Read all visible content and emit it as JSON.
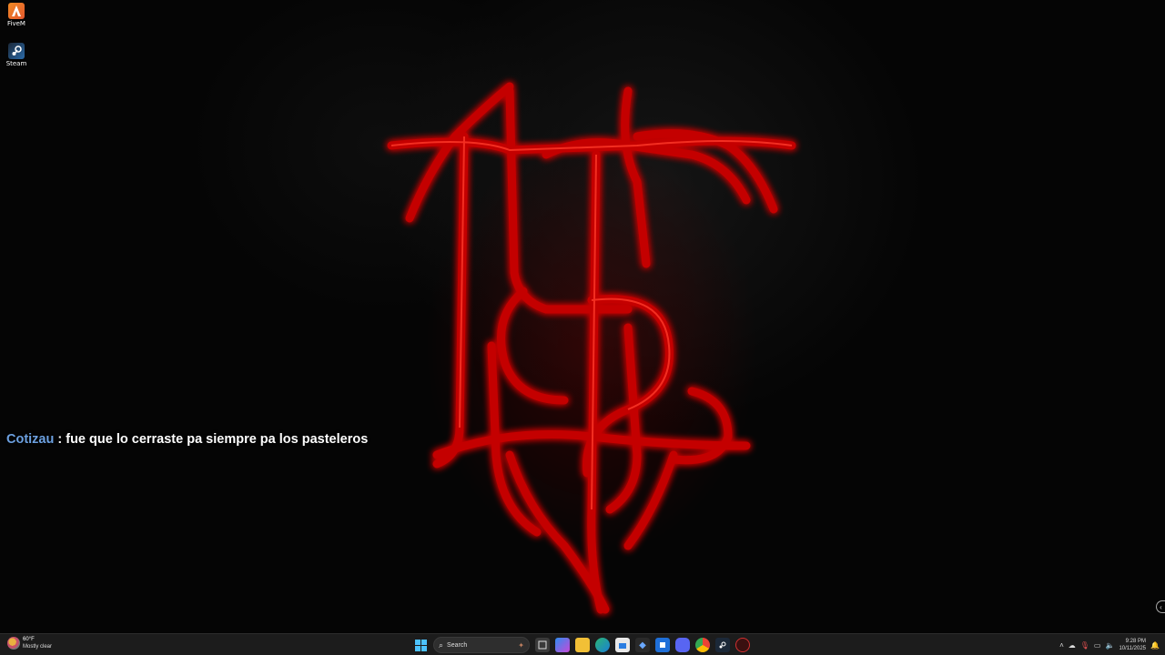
{
  "desktop": {
    "icons": [
      {
        "label": "FiveM",
        "icon": "fivem-icon"
      },
      {
        "label": "Steam",
        "icon": "steam-icon"
      }
    ]
  },
  "chat": {
    "username": "Cotizau",
    "separator": " : ",
    "message": "fue que lo cerraste pa siempre pa los pasteleros",
    "username_color": "#6ca0e0"
  },
  "taskbar": {
    "weather": {
      "temp": "60°F",
      "condition": "Mostly clear"
    },
    "search_placeholder": "Search",
    "apps": [
      "windows-start-icon",
      "search-icon",
      "task-view-icon",
      "copilot-icon",
      "file-explorer-icon",
      "edge-icon",
      "store-icon",
      "vpn-icon",
      "outlook-icon",
      "discord-icon",
      "chrome-icon",
      "steam-icon",
      "fivem-tray-icon"
    ],
    "tray": {
      "time": "9:28 PM",
      "date": "10/11/2025"
    }
  },
  "colors": {
    "accent_red": "#d00000",
    "taskbar": "#1c1c1c"
  }
}
